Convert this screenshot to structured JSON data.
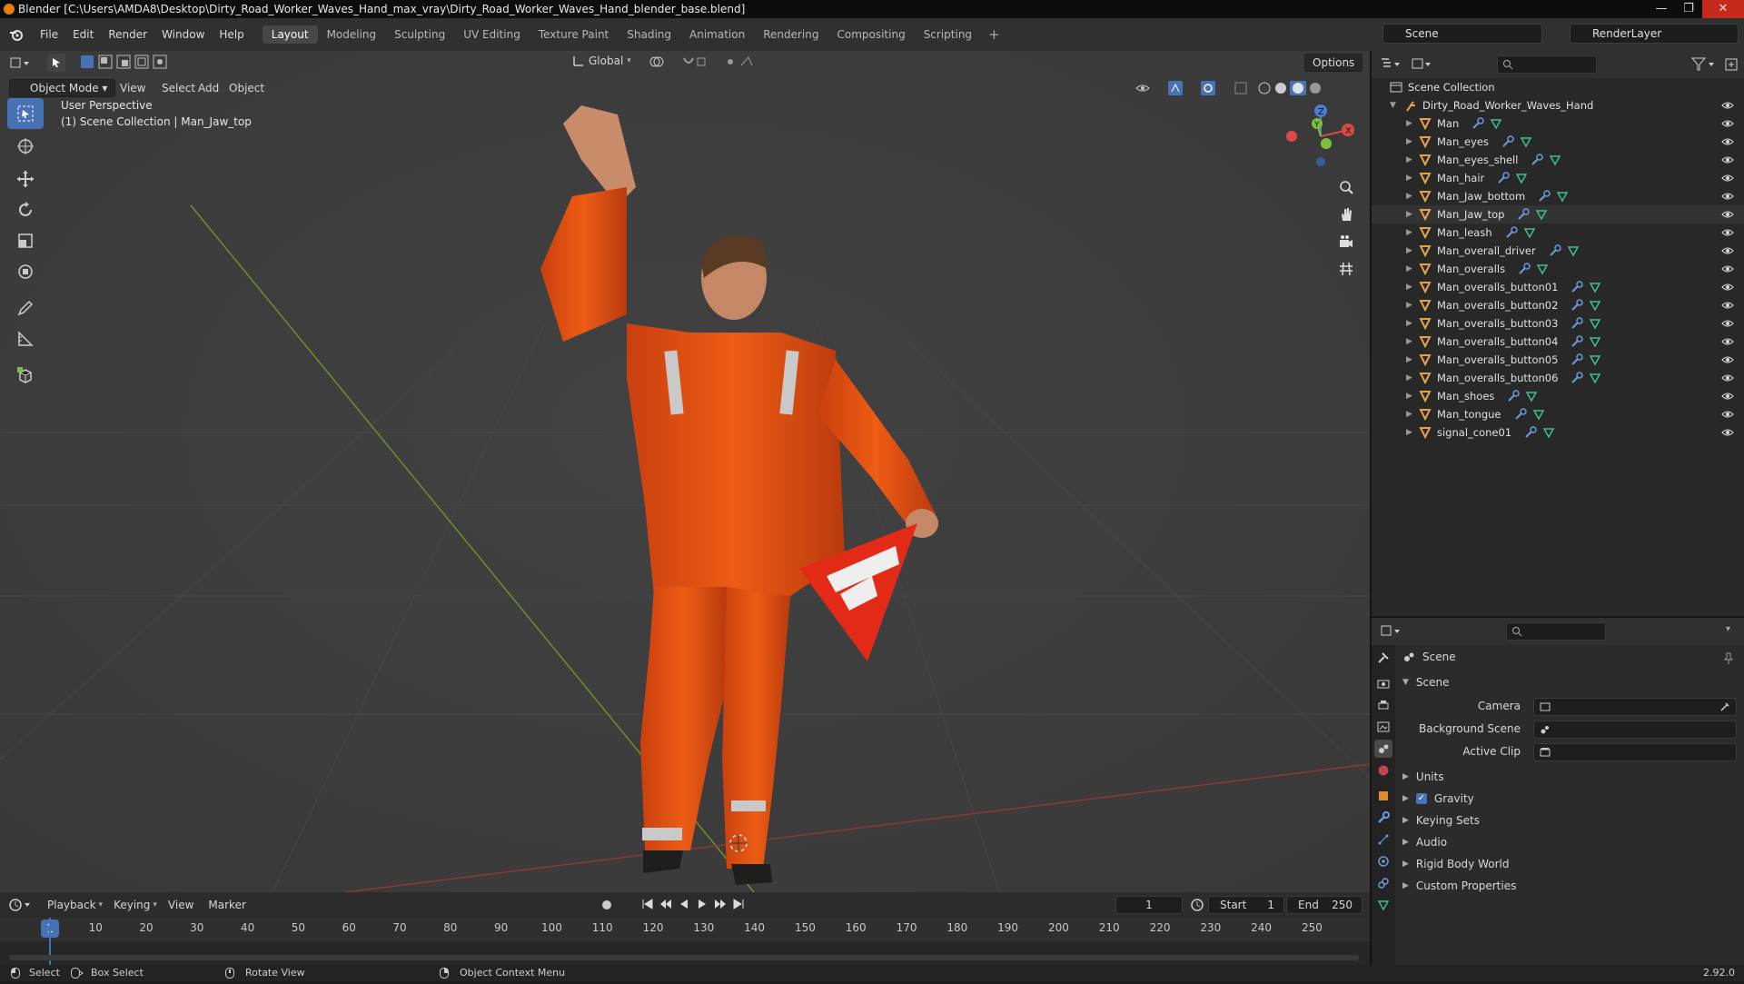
{
  "title_bar": {
    "text": "Blender [C:\\Users\\AMDA8\\Desktop\\Dirty_Road_Worker_Waves_Hand_max_vray\\Dirty_Road_Worker_Waves_Hand_blender_base.blend]",
    "buttons": [
      "—",
      "❐",
      "✕"
    ]
  },
  "menu": [
    "File",
    "Edit",
    "Render",
    "Window",
    "Help"
  ],
  "workspaces": [
    "Layout",
    "Modeling",
    "Sculpting",
    "UV Editing",
    "Texture Paint",
    "Shading",
    "Animation",
    "Rendering",
    "Compositing",
    "Scripting"
  ],
  "workspace_add": "+",
  "scene_name": "Scene",
  "view_layer": "RenderLayer",
  "viewport": {
    "mode": "Object Mode",
    "menus": [
      "View",
      "Select",
      "Add",
      "Object"
    ],
    "orientation": "Global",
    "options_label": "Options",
    "overlay_title": "User Perspective",
    "overlay_sub": "(1) Scene Collection | Man_Jaw_top",
    "gizmo_axes": [
      "Z",
      "Y",
      "X"
    ],
    "accent": "#4772b3"
  },
  "outliner": {
    "root": "Scene Collection",
    "collection": "Dirty_Road_Worker_Waves_Hand",
    "objects": [
      "Man",
      "Man_eyes",
      "Man_eyes_shell",
      "Man_hair",
      "Man_Jaw_bottom",
      "Man_Jaw_top",
      "Man_leash",
      "Man_overall_driver",
      "Man_overalls",
      "Man_overalls_button01",
      "Man_overalls_button02",
      "Man_overalls_button03",
      "Man_overalls_button04",
      "Man_overalls_button05",
      "Man_overalls_button06",
      "Man_shoes",
      "Man_tongue",
      "signal_cone01"
    ],
    "active_object": "Man_Jaw_top"
  },
  "properties": {
    "context": "Scene",
    "panel": "Scene",
    "fields": [
      {
        "label": "Camera",
        "value": ""
      },
      {
        "label": "Background Scene",
        "value": ""
      },
      {
        "label": "Active Clip",
        "value": ""
      }
    ],
    "subpanels": [
      "Units",
      "Gravity",
      "Keying Sets",
      "Audio",
      "Rigid Body World",
      "Custom Properties"
    ],
    "gravity_checked": true
  },
  "timeline": {
    "menus": [
      "Playback",
      "Keying",
      "View",
      "Marker"
    ],
    "current_frame": "1",
    "start_label": "Start",
    "start": "1",
    "end_label": "End",
    "end": "250",
    "ticks": [
      "1",
      "10",
      "20",
      "30",
      "40",
      "50",
      "60",
      "70",
      "80",
      "90",
      "100",
      "110",
      "120",
      "130",
      "140",
      "150",
      "160",
      "170",
      "180",
      "190",
      "200",
      "210",
      "220",
      "230",
      "240",
      "250"
    ]
  },
  "status_bar": {
    "items": [
      "Select",
      "Box Select",
      "Rotate View",
      "Object Context Menu"
    ],
    "version": "2.92.0"
  }
}
